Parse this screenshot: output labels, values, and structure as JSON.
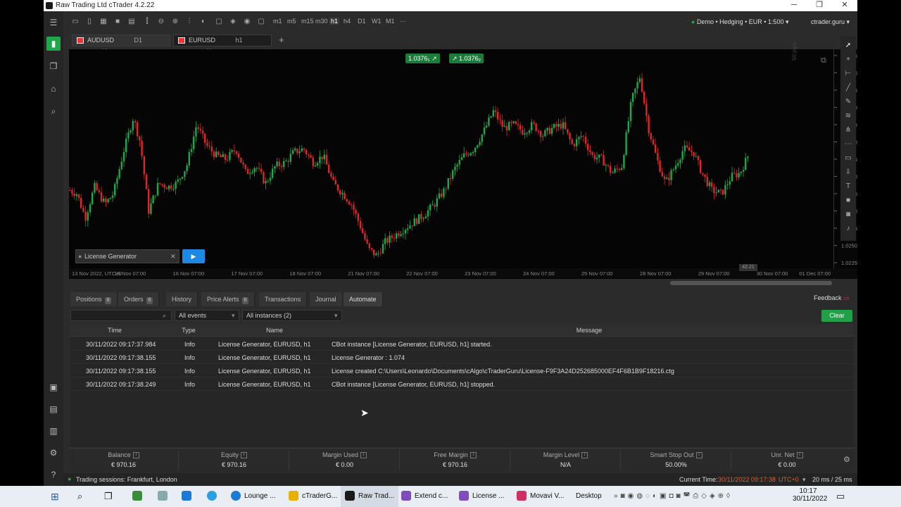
{
  "window": {
    "title": "Raw Trading Ltd cTrader 4.2.22",
    "min": "─",
    "max": "❐",
    "close": "✕"
  },
  "account_bar": {
    "status": "Demo • Hedging • EUR • 1:500",
    "user": "ctrader.guru"
  },
  "toolbar": {
    "timeframes": [
      "m1",
      "m5",
      "m15",
      "m30",
      "h1",
      "h4",
      "D1",
      "W1",
      "M1"
    ],
    "more": "···"
  },
  "chart_tabs": [
    {
      "symbol": "AUDUSD",
      "tf": "D1"
    },
    {
      "symbol": "EURUSD",
      "tf": "h1"
    }
  ],
  "price_tags": {
    "bid": "1.0376₁",
    "ask": "1.0376₂"
  },
  "pips_label": "50 pips",
  "bot": {
    "name": "License Generator",
    "play": "▶"
  },
  "chart_data": {
    "type": "candlestick",
    "symbol": "EURUSD",
    "timeframe": "h1",
    "y_ticks": [
      "1.0525",
      "1.0500",
      "1.0475",
      "1.0450",
      "1.0425",
      "1.0400",
      "1.0375",
      "1.0350",
      "1.0325",
      "1.0300",
      "1.0275",
      "1.0250",
      "1.0225"
    ],
    "x_ticks": [
      "13 Nov 2022, UTC+0",
      "15 Nov 07:00",
      "16 Nov 07:00",
      "17 Nov 07:00",
      "18 Nov 07:00",
      "21 Nov 07:00",
      "22 Nov 07:00",
      "23 Nov 07:00",
      "24 Nov 07:00",
      "25 Nov 07:00",
      "28 Nov 07:00",
      "29 Nov 07:00",
      "30 Nov 07:00",
      "01 Dec 07:00"
    ],
    "ylim": [
      1.022,
      1.053
    ],
    "path": [
      [
        0,
        1.033
      ],
      [
        10,
        1.0325
      ],
      [
        22,
        1.029
      ],
      [
        35,
        1.0335
      ],
      [
        50,
        1.031
      ],
      [
        62,
        1.0325
      ],
      [
        76,
        1.0385
      ],
      [
        90,
        1.0435
      ],
      [
        100,
        1.04
      ],
      [
        112,
        1.03
      ],
      [
        126,
        1.034
      ],
      [
        140,
        1.0335
      ],
      [
        152,
        1.034
      ],
      [
        166,
        1.0365
      ],
      [
        180,
        1.0425
      ],
      [
        194,
        1.0395
      ],
      [
        208,
        1.038
      ],
      [
        222,
        1.0375
      ],
      [
        236,
        1.039
      ],
      [
        250,
        1.0355
      ],
      [
        264,
        1.0365
      ],
      [
        278,
        1.034
      ],
      [
        292,
        1.0365
      ],
      [
        306,
        1.037
      ],
      [
        318,
        1.0385
      ],
      [
        332,
        1.039
      ],
      [
        346,
        1.037
      ],
      [
        360,
        1.038
      ],
      [
        374,
        1.034
      ],
      [
        388,
        1.0325
      ],
      [
        400,
        1.031
      ],
      [
        412,
        1.028
      ],
      [
        424,
        1.0245
      ],
      [
        436,
        1.0235
      ],
      [
        448,
        1.0255
      ],
      [
        462,
        1.0265
      ],
      [
        476,
        1.0275
      ],
      [
        490,
        1.0285
      ],
      [
        504,
        1.0295
      ],
      [
        518,
        1.031
      ],
      [
        532,
        1.033
      ],
      [
        546,
        1.036
      ],
      [
        560,
        1.038
      ],
      [
        574,
        1.039
      ],
      [
        588,
        1.0415
      ],
      [
        602,
        1.0445
      ],
      [
        616,
        1.042
      ],
      [
        630,
        1.0425
      ],
      [
        644,
        1.0415
      ],
      [
        658,
        1.0425
      ],
      [
        672,
        1.041
      ],
      [
        686,
        1.042
      ],
      [
        700,
        1.0425
      ],
      [
        714,
        1.0395
      ],
      [
        728,
        1.041
      ],
      [
        742,
        1.038
      ],
      [
        756,
        1.0375
      ],
      [
        770,
        1.0355
      ],
      [
        784,
        1.0365
      ],
      [
        798,
        1.046
      ],
      [
        810,
        1.0495
      ],
      [
        822,
        1.042
      ],
      [
        834,
        1.0375
      ],
      [
        846,
        1.034
      ],
      [
        860,
        1.0365
      ],
      [
        872,
        1.039
      ],
      [
        886,
        1.0385
      ],
      [
        898,
        1.0355
      ],
      [
        912,
        1.033
      ],
      [
        926,
        1.0325
      ],
      [
        940,
        1.035
      ],
      [
        952,
        1.0355
      ],
      [
        966,
        1.0385
      ]
    ]
  },
  "current_price_label": "42.21",
  "bottom_tabs": [
    {
      "label": "Positions",
      "badge": "0"
    },
    {
      "label": "Orders",
      "badge": "0"
    },
    {
      "label": "History"
    },
    {
      "label": "Price Alerts",
      "badge": "0"
    },
    {
      "label": "Transactions"
    },
    {
      "label": "Journal"
    },
    {
      "label": "Automate"
    }
  ],
  "feedback": "Feedback",
  "filters": {
    "search": "",
    "events": "All events",
    "instances": "All instances (2)",
    "clear": "Clear"
  },
  "log": {
    "headers": [
      "Time",
      "Type",
      "Name",
      "Message"
    ],
    "rows": [
      [
        "30/11/2022 09:17:37.984",
        "Info",
        "License Generator, EURUSD, h1",
        "CBot instance [License Generator, EURUSD, h1] started."
      ],
      [
        "30/11/2022 09:17:38.155",
        "Info",
        "License Generator, EURUSD, h1",
        "License Generator : 1.074"
      ],
      [
        "30/11/2022 09:17:38.155",
        "Info",
        "License Generator, EURUSD, h1",
        "License created C:\\Users\\Leonardo\\Documents\\cAlgo\\cTraderGuru\\License-F9F3A24D252685000EF4F6B1B9F18216.ctg"
      ],
      [
        "30/11/2022 09:17:38.249",
        "Info",
        "License Generator, EURUSD, h1",
        "CBot instance [License Generator, EURUSD, h1] stopped."
      ]
    ]
  },
  "account": [
    {
      "label": "Balance",
      "value": "€ 970.16"
    },
    {
      "label": "Equity",
      "value": "€ 970.16"
    },
    {
      "label": "Margin Used",
      "value": "€ 0.00"
    },
    {
      "label": "Free Margin",
      "value": "€ 970.16"
    },
    {
      "label": "Margin Level",
      "value": "N/A"
    },
    {
      "label": "Smart Stop Out",
      "value": "50.00%"
    },
    {
      "label": "Unr. Net",
      "value": "€ 0.00"
    }
  ],
  "statusbar": {
    "sessions": "Trading sessions: Frankfurt, London",
    "current_time_label": "Current Time:",
    "current_time": "30/11/2022 09:17:38",
    "tz": "UTC+0",
    "latency": "20 ms / 25 ms"
  },
  "taskbar": {
    "apps": [
      {
        "label": "Lounge ...",
        "color": "#1b7bd4"
      },
      {
        "label": "cTraderG...",
        "color": "#e8b100"
      },
      {
        "label": "Raw Trad...",
        "color": "#1a1a1a"
      },
      {
        "label": "Extend c...",
        "color": "#7c4dbb"
      },
      {
        "label": "License ...",
        "color": "#7c4dbb"
      },
      {
        "label": "Movavi V...",
        "color": "#d03060"
      }
    ],
    "desktop": "Desktop",
    "time": "10:17",
    "date": "30/11/2022"
  },
  "colors": {
    "up": "#1fa84a",
    "down": "#e02525",
    "accent": "#21a04a",
    "play": "#1e88e5"
  }
}
